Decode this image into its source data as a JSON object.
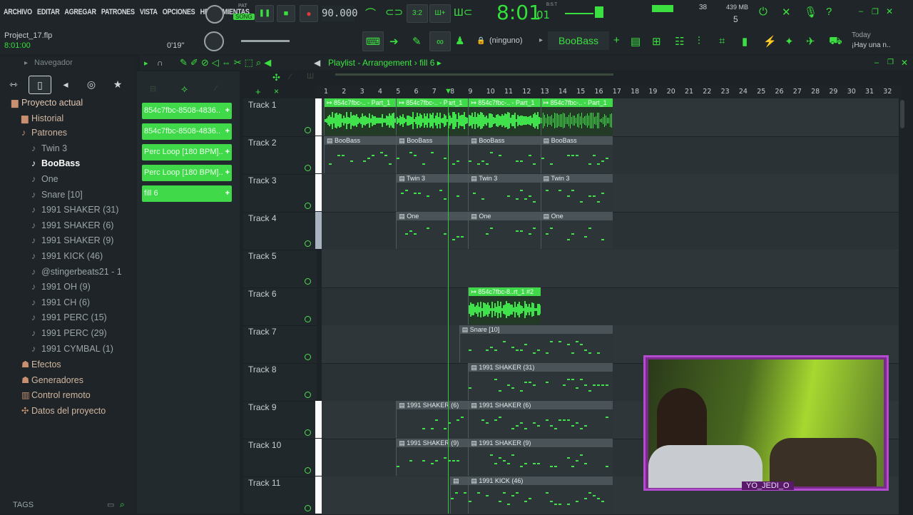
{
  "menu": [
    "ARCHIVO",
    "EDITAR",
    "AGREGAR",
    "PATRONES",
    "VISTA",
    "OPCIONES",
    "HERRAMIENTAS"
  ],
  "topbar": {
    "pat_label": "PAT",
    "song_label": "SONG",
    "tempo": "90.000",
    "time_main": "8:01",
    "time_sub": "01",
    "time_tag": "B:S:T",
    "cpu_value": "38",
    "mem_value": "439 MB",
    "voices": "5",
    "project_name": "Project_17.flp",
    "position": "8:01:00",
    "mixer_time": "0'19\"",
    "pattern_selector": "(ninguno)",
    "instrument_name": "BooBass",
    "hint_top": "Today",
    "hint_bottom": "¡Hay una n.."
  },
  "browser": {
    "title": "Navegador",
    "tags_label": "TAGS",
    "items": [
      {
        "label": "Proyecto actual",
        "level": 0,
        "icon": "folder-icon",
        "color": "#e2c6b2"
      },
      {
        "label": "Historial",
        "level": 1,
        "icon": "folder-icon",
        "color": "#d1b6a0"
      },
      {
        "label": "Patrones",
        "level": 1,
        "icon": "note-icon",
        "color": "#d1b6a0"
      },
      {
        "label": "Twin 3",
        "level": 2,
        "icon": "note-icon",
        "color": "#9ba5aa"
      },
      {
        "label": "BooBass",
        "level": 2,
        "icon": "note-icon",
        "color": "#ffffff"
      },
      {
        "label": "One",
        "level": 2,
        "icon": "note-icon",
        "color": "#9ba5aa"
      },
      {
        "label": "Snare [10]",
        "level": 2,
        "icon": "note-icon",
        "color": "#9ba5aa"
      },
      {
        "label": "1991 SHAKER (31)",
        "level": 2,
        "icon": "note-icon",
        "color": "#9ba5aa"
      },
      {
        "label": "1991 SHAKER (6)",
        "level": 2,
        "icon": "note-icon",
        "color": "#9ba5aa"
      },
      {
        "label": "1991 SHAKER (9)",
        "level": 2,
        "icon": "note-icon",
        "color": "#9ba5aa"
      },
      {
        "label": "1991 KICK (46)",
        "level": 2,
        "icon": "note-icon",
        "color": "#9ba5aa"
      },
      {
        "label": "@stingerbeats21 - 1",
        "level": 2,
        "icon": "note-icon",
        "color": "#9ba5aa"
      },
      {
        "label": "1991 OH (9)",
        "level": 2,
        "icon": "note-icon",
        "color": "#9ba5aa"
      },
      {
        "label": "1991 CH (6)",
        "level": 2,
        "icon": "note-icon",
        "color": "#9ba5aa"
      },
      {
        "label": "1991 PERC (15)",
        "level": 2,
        "icon": "note-icon",
        "color": "#9ba5aa"
      },
      {
        "label": "1991 PERC (29)",
        "level": 2,
        "icon": "note-icon",
        "color": "#9ba5aa"
      },
      {
        "label": "1991 CYMBAL (1)",
        "level": 2,
        "icon": "note-icon",
        "color": "#9ba5aa"
      },
      {
        "label": "Efectos",
        "level": 1,
        "icon": "plug-icon",
        "color": "#d1b6a0"
      },
      {
        "label": "Generadores",
        "level": 1,
        "icon": "plug-icon",
        "color": "#d1b6a0"
      },
      {
        "label": "Control remoto",
        "level": 1,
        "icon": "remote-icon",
        "color": "#d1b6a0"
      },
      {
        "label": "Datos del proyecto",
        "level": 1,
        "icon": "data-icon",
        "color": "#d1b6a0"
      }
    ]
  },
  "patterns": [
    "854c7fbc-8508-4836..",
    "854c7fbc-8508-4836..",
    "Perc Loop [180 BPM]..",
    "Perc Loop [180 BPM]..",
    "fill 6"
  ],
  "playlist": {
    "title": "Playlist - Arrangement",
    "pattern": "fill 6",
    "bars": [
      "1",
      "2",
      "3",
      "4",
      "5",
      "6",
      "7",
      "8",
      "9",
      "10",
      "11",
      "12",
      "13",
      "14",
      "15",
      "16",
      "17",
      "18",
      "19",
      "20",
      "21",
      "22",
      "23",
      "24",
      "25",
      "26",
      "27",
      "28",
      "29",
      "30",
      "31",
      "32"
    ],
    "tracks": [
      "Track 1",
      "Track 2",
      "Track 3",
      "Track 4",
      "Track 5",
      "Track 6",
      "Track 7",
      "Track 8",
      "Track 9",
      "Track 10",
      "Track 11"
    ],
    "clips": [
      {
        "track": 0,
        "start": 1,
        "len": 4,
        "label": "854c7fbc-.. - Part_1",
        "type": "audio"
      },
      {
        "track": 0,
        "start": 5,
        "len": 4,
        "label": "854c7fbc-.. - Part_1",
        "type": "audio"
      },
      {
        "track": 0,
        "start": 9,
        "len": 4,
        "label": "854c7fbc-.. - Part_1",
        "type": "audio"
      },
      {
        "track": 0,
        "start": 13,
        "len": 4,
        "label": "854c7fbc-.. - Part_1",
        "type": "audio"
      },
      {
        "track": 1,
        "start": 1,
        "len": 4,
        "label": "BooBass",
        "type": "pattern"
      },
      {
        "track": 1,
        "start": 5,
        "len": 4,
        "label": "BooBass",
        "type": "pattern"
      },
      {
        "track": 1,
        "start": 9,
        "len": 4,
        "label": "BooBass",
        "type": "pattern"
      },
      {
        "track": 1,
        "start": 13,
        "len": 4,
        "label": "BooBass",
        "type": "pattern"
      },
      {
        "track": 2,
        "start": 5,
        "len": 4,
        "label": "Twin 3",
        "type": "pattern"
      },
      {
        "track": 2,
        "start": 9,
        "len": 4,
        "label": "Twin 3",
        "type": "pattern"
      },
      {
        "track": 2,
        "start": 13,
        "len": 4,
        "label": "Twin 3",
        "type": "pattern"
      },
      {
        "track": 3,
        "start": 5,
        "len": 4,
        "label": "One",
        "type": "pattern"
      },
      {
        "track": 3,
        "start": 9,
        "len": 4,
        "label": "One",
        "type": "pattern"
      },
      {
        "track": 3,
        "start": 13,
        "len": 4,
        "label": "One",
        "type": "pattern"
      },
      {
        "track": 5,
        "start": 9,
        "len": 4,
        "label": "854c7fbc-8..rt_1 #2",
        "type": "audio"
      },
      {
        "track": 6,
        "start": 8.5,
        "len": 8.5,
        "label": "Snare [10]",
        "type": "pattern"
      },
      {
        "track": 7,
        "start": 9,
        "len": 8,
        "label": "1991 SHAKER (31)",
        "type": "pattern"
      },
      {
        "track": 8,
        "start": 5,
        "len": 4,
        "label": "1991 SHAKER (6)",
        "type": "pattern"
      },
      {
        "track": 8,
        "start": 9,
        "len": 8,
        "label": "1991 SHAKER (6)",
        "type": "pattern"
      },
      {
        "track": 9,
        "start": 5,
        "len": 4,
        "label": "1991 SHAKER (9)",
        "type": "pattern"
      },
      {
        "track": 9,
        "start": 9,
        "len": 8,
        "label": "1991 SHAKER (9)",
        "type": "pattern"
      },
      {
        "track": 10,
        "start": 8,
        "len": 1,
        "label": "",
        "type": "pattern"
      },
      {
        "track": 10,
        "start": 9,
        "len": 8,
        "label": "1991 KICK (46)",
        "type": "pattern"
      }
    ]
  },
  "webcam": {
    "label": "YO_JEDI_O"
  },
  "colors": {
    "accent": "#3be040",
    "bg": "#1c2226",
    "panel": "#2b3236"
  }
}
